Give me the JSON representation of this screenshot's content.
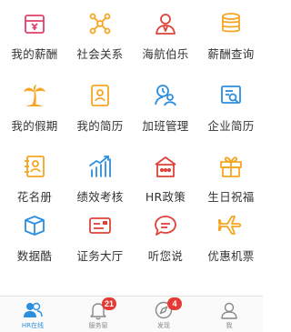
{
  "colors": {
    "pink": "#e0406a",
    "orange": "#f5a623",
    "red": "#e0413a",
    "blue": "#2b8fe0",
    "badge": "#e53935"
  },
  "grid": {
    "items": [
      {
        "label": "我的薪酬",
        "icon": "salary-wallet-icon"
      },
      {
        "label": "社会关系",
        "icon": "social-network-icon"
      },
      {
        "label": "海航伯乐",
        "icon": "recruiter-person-icon"
      },
      {
        "label": "薪酬查询",
        "icon": "coin-stack-icon"
      },
      {
        "label": "我的假期",
        "icon": "palm-tree-icon"
      },
      {
        "label": "我的简历",
        "icon": "resume-person-icon"
      },
      {
        "label": "加班管理",
        "icon": "overtime-clock-person-icon"
      },
      {
        "label": "企业简历",
        "icon": "enterprise-search-doc-icon"
      },
      {
        "label": "花名册",
        "icon": "roster-book-icon"
      },
      {
        "label": "绩效考核",
        "icon": "bar-trend-chart-icon"
      },
      {
        "label": "HR政策",
        "icon": "policy-house-icon"
      },
      {
        "label": "生日祝福",
        "icon": "gift-box-icon"
      },
      {
        "label": "数据酷",
        "icon": "data-cube-icon"
      },
      {
        "label": "证务大厅",
        "icon": "id-card-icon"
      },
      {
        "label": "听您说",
        "icon": "speech-bubble-icon"
      },
      {
        "label": "优惠机票",
        "icon": "airplane-icon"
      }
    ]
  },
  "tabbar": {
    "tabs": [
      {
        "label": "HR在线",
        "icon": "people-icon",
        "active": true,
        "badge": ""
      },
      {
        "label": "服务窗",
        "icon": "bell-icon",
        "active": false,
        "badge": "21"
      },
      {
        "label": "发现",
        "icon": "compass-icon",
        "active": false,
        "badge": "4"
      },
      {
        "label": "我",
        "icon": "person-icon",
        "active": false,
        "badge": ""
      }
    ]
  }
}
